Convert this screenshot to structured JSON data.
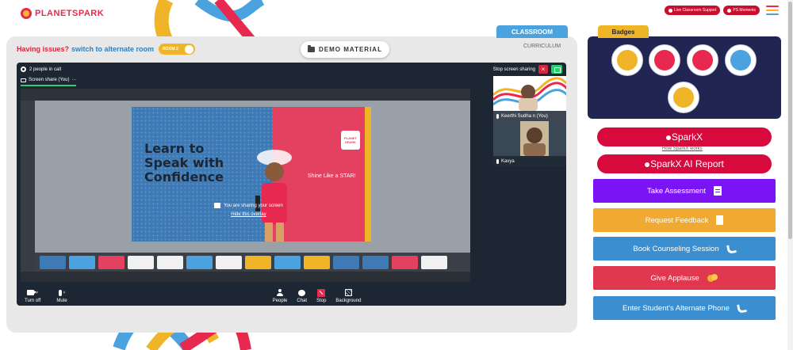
{
  "app": {
    "logo_text": "PLANETSPARK"
  },
  "header": {
    "live_support_label": "Live Classroom Support",
    "ps_moments_label": "PS Moments",
    "menu_icon": "hamburger-icon",
    "colors": {
      "accent_red": "#c8102e",
      "menu_lines": [
        "#e8294f",
        "#f0b429",
        "#4aa3df"
      ]
    }
  },
  "classroom": {
    "issues_text": "Having issues?",
    "switch_text": "switch to alternate room",
    "room_toggle_label": "ROOM 2",
    "demo_material_label": "DEMO MATERIAL",
    "tab_classroom": "CLASSROOM",
    "tab_curriculum": "CURRICULUM"
  },
  "call": {
    "people_count": "2 people in call",
    "stop_sharing_label": "Stop screen sharing",
    "share_tab_label": "Screen share (You)",
    "share_tab_more": "···",
    "shared_slide": {
      "heading": "Learn to Speak with Confidence",
      "tagline": "Shine Like a STAR!",
      "badge_text": "PLANET SPARK"
    },
    "overlay_title": "You are sharing your screen",
    "overlay_link": "Hide this overlay",
    "participants": [
      {
        "name": "Keerthi Sudha n (You)"
      },
      {
        "name": "Kavya"
      }
    ],
    "controls": {
      "turn_off": "Turn off",
      "mute": "Mute",
      "people": "People",
      "chat": "Chat",
      "stop": "Stop",
      "background": "Background"
    }
  },
  "toolbar": {
    "icons": [
      "expand-icon",
      "power-icon",
      "screen-icon",
      "palette-icon"
    ]
  },
  "sidebar": {
    "badges_title": "Badges",
    "badge_colors": [
      "#f0b429",
      "#e8294f",
      "#e8294f",
      "#4aa3df",
      "#f0b429"
    ],
    "sparkx_label": "SparkX",
    "how_sparkx_label": "How SparkX works",
    "sparkx_ai_label": "SparkX AI Report",
    "actions": [
      {
        "label": "Take Assessment",
        "color": "#7b14f5",
        "icon": "clipboard-icon"
      },
      {
        "label": "Request Feedback",
        "color": "#f0aa32",
        "icon": "document-icon"
      },
      {
        "label": "Book Counseling Session",
        "color": "#3b8fd0",
        "icon": "phone-icon"
      },
      {
        "label": "Give Applause",
        "color": "#e0394f",
        "icon": "clap-icon"
      },
      {
        "label": "Enter Student's Alternate Phone",
        "color": "#3b8fd0",
        "icon": "phone-icon"
      }
    ]
  }
}
